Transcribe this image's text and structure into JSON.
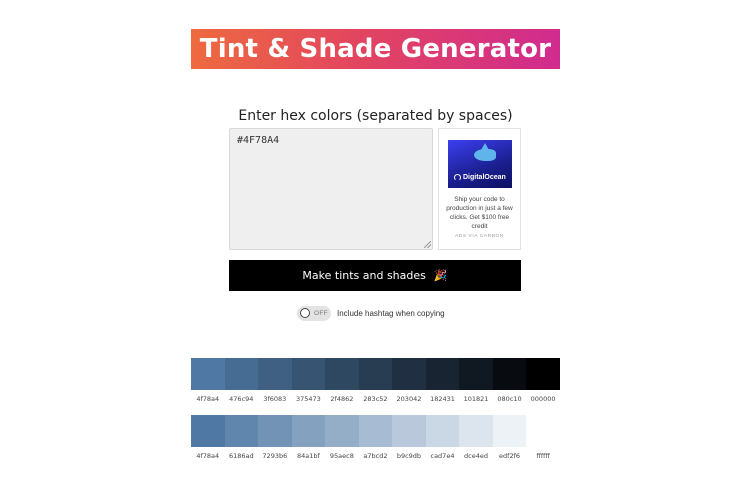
{
  "title": "Tint & Shade Generator",
  "prompt": "Enter hex colors (separated by spaces)",
  "input": {
    "value": "#4F78A4"
  },
  "ad": {
    "brand": "DigitalOcean",
    "text": "Ship your code to production in just a few clicks. Get $100 free credit",
    "via": "ADS VIA CARBON"
  },
  "make_button": {
    "label": "Make tints and shades",
    "icon": "party-popper-icon"
  },
  "toggle": {
    "state_label": "OFF",
    "label": "Include hashtag when copying",
    "on": false
  },
  "colors": {
    "accent_start": "#ee6a3f",
    "accent_end": "#d12b8f",
    "button": "#000000"
  },
  "shades": [
    {
      "hex": "4f78a4",
      "color": "#4f78a4"
    },
    {
      "hex": "476c94",
      "color": "#476c94"
    },
    {
      "hex": "3f6083",
      "color": "#3f6083"
    },
    {
      "hex": "375473",
      "color": "#375473"
    },
    {
      "hex": "2f4862",
      "color": "#2f4862"
    },
    {
      "hex": "283c52",
      "color": "#283c52"
    },
    {
      "hex": "203042",
      "color": "#203042"
    },
    {
      "hex": "182431",
      "color": "#182431"
    },
    {
      "hex": "101821",
      "color": "#101821"
    },
    {
      "hex": "080c10",
      "color": "#080c10"
    },
    {
      "hex": "000000",
      "color": "#000000"
    }
  ],
  "tints": [
    {
      "hex": "4f78a4",
      "color": "#4f78a4"
    },
    {
      "hex": "6186ad",
      "color": "#6186ad"
    },
    {
      "hex": "7293b6",
      "color": "#7293b6"
    },
    {
      "hex": "84a1bf",
      "color": "#84a1bf"
    },
    {
      "hex": "95aec8",
      "color": "#95aec8"
    },
    {
      "hex": "a7bcd2",
      "color": "#a7bcd2"
    },
    {
      "hex": "b9c9db",
      "color": "#b9c9db"
    },
    {
      "hex": "cad7e4",
      "color": "#cad7e4"
    },
    {
      "hex": "dce4ed",
      "color": "#dce4ed"
    },
    {
      "hex": "edf2f6",
      "color": "#edf2f6"
    },
    {
      "hex": "ffffff",
      "color": "#ffffff"
    }
  ]
}
